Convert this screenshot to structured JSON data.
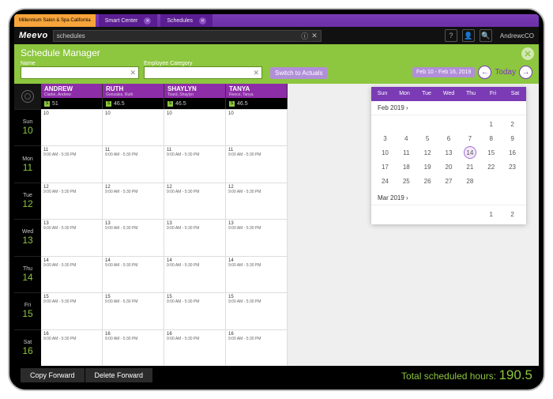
{
  "org": "Millennium Salon & Spa California",
  "tabs": [
    {
      "label": "Smart Center"
    },
    {
      "label": "Schedules"
    }
  ],
  "logo": "Meevo",
  "search": {
    "value": "schedules",
    "info": "ⓘ",
    "clear": "✕"
  },
  "topright": {
    "help": "?",
    "user": "AndrewcCO"
  },
  "panel": {
    "title": "Schedule Manager",
    "name_label": "Name",
    "cat_label": "Employee Category",
    "switch": "Switch to Actuals",
    "range": "Feb 10 - Feb 16, 2019",
    "today": "Today"
  },
  "employees": [
    {
      "name": "ANDREW",
      "sub": "Clarke, Andrew",
      "hours": "51"
    },
    {
      "name": "RUTH",
      "sub": "Gonzales, Ruth",
      "hours": "46.5"
    },
    {
      "name": "SHAYLYN",
      "sub": "Toard, Shaylyn",
      "hours": "46.5"
    },
    {
      "name": "TANYA",
      "sub": "Reece, Tanya",
      "hours": "46.5"
    }
  ],
  "days": [
    {
      "d": "Sun",
      "n": "10"
    },
    {
      "d": "Mon",
      "n": "11"
    },
    {
      "d": "Tue",
      "n": "12"
    },
    {
      "d": "Wed",
      "n": "13"
    },
    {
      "d": "Thu",
      "n": "14"
    },
    {
      "d": "Fri",
      "n": "15"
    },
    {
      "d": "Sat",
      "n": "16"
    }
  ],
  "schedule": [
    [
      "10",
      "10",
      "10",
      "10"
    ],
    [
      "11|9:00 AM - 5:30 PM",
      "11|9:00 AM - 5:30 PM",
      "11|9:00 AM - 5:30 PM",
      "11|9:00 AM - 5:30 PM"
    ],
    [
      "12|9:00 AM - 5:30 PM",
      "12|9:00 AM - 5:30 PM",
      "12|9:00 AM - 5:30 PM",
      "12|9:00 AM - 5:30 PM"
    ],
    [
      "13|9:00 AM - 5:30 PM",
      "13|9:00 AM - 5:30 PM",
      "13|9:00 AM - 5:30 PM",
      "13|9:00 AM - 5:30 PM"
    ],
    [
      "14|9:00 AM - 5:30 PM",
      "14|9:00 AM - 5:30 PM",
      "14|9:00 AM - 5:30 PM",
      "14|9:00 AM - 5:30 PM"
    ],
    [
      "15|9:00 AM - 5:30 PM",
      "15|9:00 AM - 5:30 PM",
      "15|9:00 AM - 5:30 PM",
      "15|9:00 AM - 5:30 PM"
    ],
    [
      "16|9:00 AM - 5:30 PM",
      "16|9:00 AM - 5:30 PM",
      "16|9:00 AM - 5:30 PM",
      "16|9:00 AM - 5:30 PM"
    ]
  ],
  "minical": {
    "dow": [
      "Sun",
      "Mon",
      "Tue",
      "Wed",
      "Thu",
      "Fri",
      "Sat"
    ],
    "month1": "Feb 2019  ›",
    "grid1": [
      [
        "",
        "",
        "",
        "",
        "",
        "1",
        "2"
      ],
      [
        "3",
        "4",
        "5",
        "6",
        "7",
        "8",
        "9"
      ],
      [
        "10",
        "11",
        "12",
        "13",
        "14",
        "15",
        "16"
      ],
      [
        "17",
        "18",
        "19",
        "20",
        "21",
        "22",
        "23"
      ],
      [
        "24",
        "25",
        "26",
        "27",
        "28",
        "",
        ""
      ]
    ],
    "selected": "14",
    "month2": "Mar 2019  ›",
    "grid2": [
      [
        "",
        "",
        "",
        "",
        "",
        "1",
        "2"
      ]
    ]
  },
  "footer": {
    "copy": "Copy Forward",
    "del": "Delete Forward",
    "total_label": "Total scheduled hours:",
    "total_value": "190.5"
  }
}
